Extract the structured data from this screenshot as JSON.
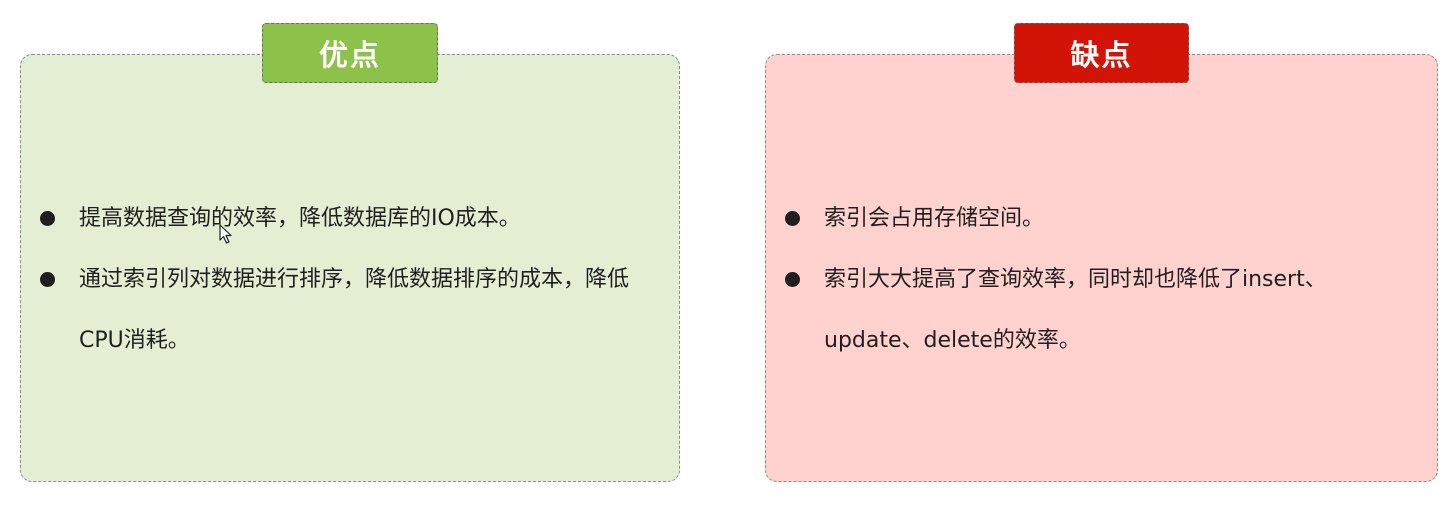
{
  "pros": {
    "title": "优点",
    "color": "#8cc24a",
    "background": "#e3eed3",
    "items": [
      "提高数据查询的效率，降低数据库的IO成本。",
      "通过索引列对数据进行排序，降低数据排序的成本，降低CPU消耗。"
    ]
  },
  "cons": {
    "title": "缺点",
    "color": "#d21406",
    "background": "#ffd2cf",
    "items": [
      "索引会占用存储空间。",
      "索引大大提高了查询效率，同时却也降低了insert、update、delete的效率。"
    ]
  },
  "icons": {
    "bullet": "bullet-dot-icon",
    "cursor": "mouse-pointer-icon"
  }
}
